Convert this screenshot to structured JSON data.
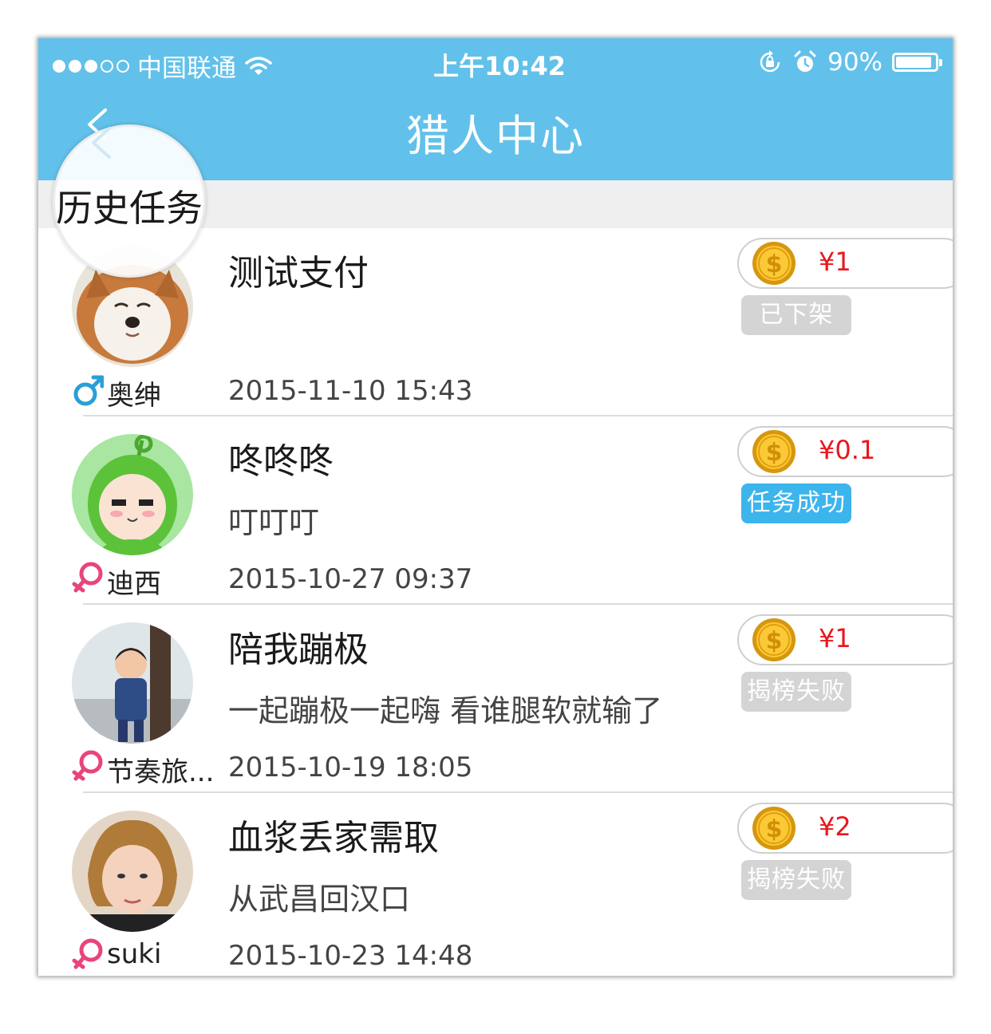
{
  "status_bar": {
    "carrier": "中国联通",
    "time": "上午10:42",
    "battery": "90%"
  },
  "nav": {
    "title": "猎人中心"
  },
  "section": {
    "title": "历史任务"
  },
  "tasks": [
    {
      "user": "奥绅",
      "gender": "male",
      "title": "测试支付",
      "desc": "",
      "time": "2015-11-10 15:43",
      "reward": "¥1",
      "status": "已下架",
      "status_type": "gray",
      "avatar": "dog"
    },
    {
      "user": "迪西",
      "gender": "female",
      "title": "咚咚咚",
      "desc": "叮叮叮",
      "time": "2015-10-27 09:37",
      "reward": "¥0.1",
      "status": "任务成功",
      "status_type": "success",
      "avatar": "teletubby"
    },
    {
      "user": "节奏旅...",
      "gender": "female",
      "title": "陪我蹦极",
      "desc": "一起蹦极一起嗨 看谁腿软就输了",
      "time": "2015-10-19 18:05",
      "reward": "¥1",
      "status": "揭榜失败",
      "status_type": "gray",
      "avatar": "child"
    },
    {
      "user": "suki",
      "gender": "female",
      "title": "血浆丢家需取",
      "desc": "从武昌回汉口",
      "time": "2015-10-23 14:48",
      "reward": "¥2",
      "status": "揭榜失败",
      "status_type": "gray",
      "avatar": "woman"
    }
  ],
  "colors": {
    "nav_bar": "#62c1ea",
    "price": "#e8161c",
    "badge_success": "#3cb4ec",
    "badge_gray": "#d4d4d4",
    "male": "#2a9fd6",
    "female": "#e8457a"
  }
}
